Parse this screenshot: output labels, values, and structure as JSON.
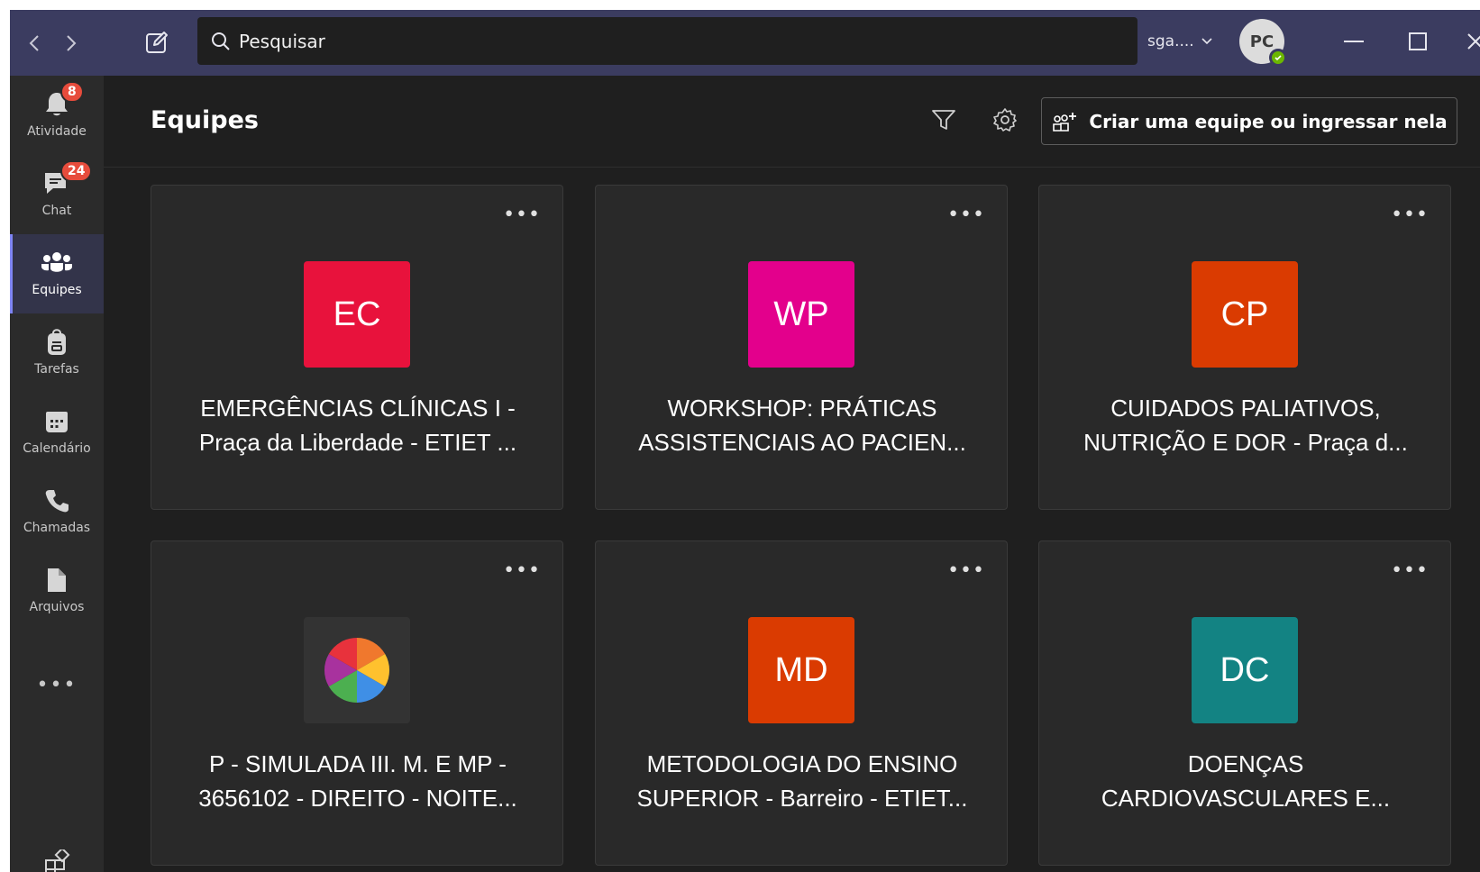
{
  "titlebar": {
    "search_placeholder": "Pesquisar",
    "org_label": "sga....",
    "avatar_initials": "PC"
  },
  "rail": {
    "items": [
      {
        "label": "Atividade",
        "icon": "bell-icon",
        "badge": "8"
      },
      {
        "label": "Chat",
        "icon": "chat-icon",
        "badge": "24"
      },
      {
        "label": "Equipes",
        "icon": "teams-icon",
        "active": true
      },
      {
        "label": "Tarefas",
        "icon": "backpack-icon"
      },
      {
        "label": "Calendário",
        "icon": "calendar-icon"
      },
      {
        "label": "Chamadas",
        "icon": "phone-icon"
      },
      {
        "label": "Arquivos",
        "icon": "file-icon"
      }
    ],
    "more_label": "•••"
  },
  "header": {
    "title": "Equipes",
    "create_label": "Criar uma equipe ou ingressar nela"
  },
  "teams": [
    {
      "initials": "EC",
      "color": "#e8123c",
      "line1": "EMERGÊNCIAS CLÍNICAS I -",
      "line2": "Praça da Liberdade - ETIET ..."
    },
    {
      "initials": "WP",
      "color": "#e3008c",
      "line1": "WORKSHOP: PRÁTICAS",
      "line2": "ASSISTENCIAIS AO PACIEN..."
    },
    {
      "initials": "CP",
      "color": "#da3b01",
      "line1": "CUIDADOS PALIATIVOS,",
      "line2": "NUTRIÇÃO E DOR - Praça d..."
    },
    {
      "initials": "",
      "color": "#333333",
      "line1": "P - SIMULADA III. M. E MP -",
      "line2": "3656102 - DIREITO - NOITE..."
    },
    {
      "initials": "MD",
      "color": "#da3b01",
      "line1": "METODOLOGIA DO ENSINO",
      "line2": "SUPERIOR - Barreiro - ETIET..."
    },
    {
      "initials": "DC",
      "color": "#138383",
      "line1": "DOENÇAS",
      "line2": "CARDIOVASCULARES E..."
    }
  ],
  "card_more_label": "•••"
}
